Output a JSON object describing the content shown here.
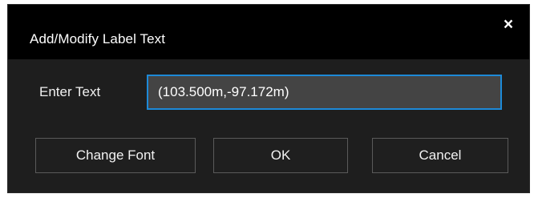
{
  "dialog": {
    "title": "Add/Modify Label Text",
    "close_glyph": "×",
    "close_icon": "close-icon"
  },
  "form": {
    "label": "Enter Text",
    "value": "(103.500m,-97.172m)"
  },
  "buttons": {
    "change_font": "Change Font",
    "ok": "OK",
    "cancel": "Cancel"
  },
  "colors": {
    "titlebar": "#000000",
    "dialog_background": "#1e1e1e",
    "input_background": "#444444",
    "input_focus_border": "#1d8ad8",
    "button_border": "#5a5a5a",
    "text": "#ffffff"
  }
}
